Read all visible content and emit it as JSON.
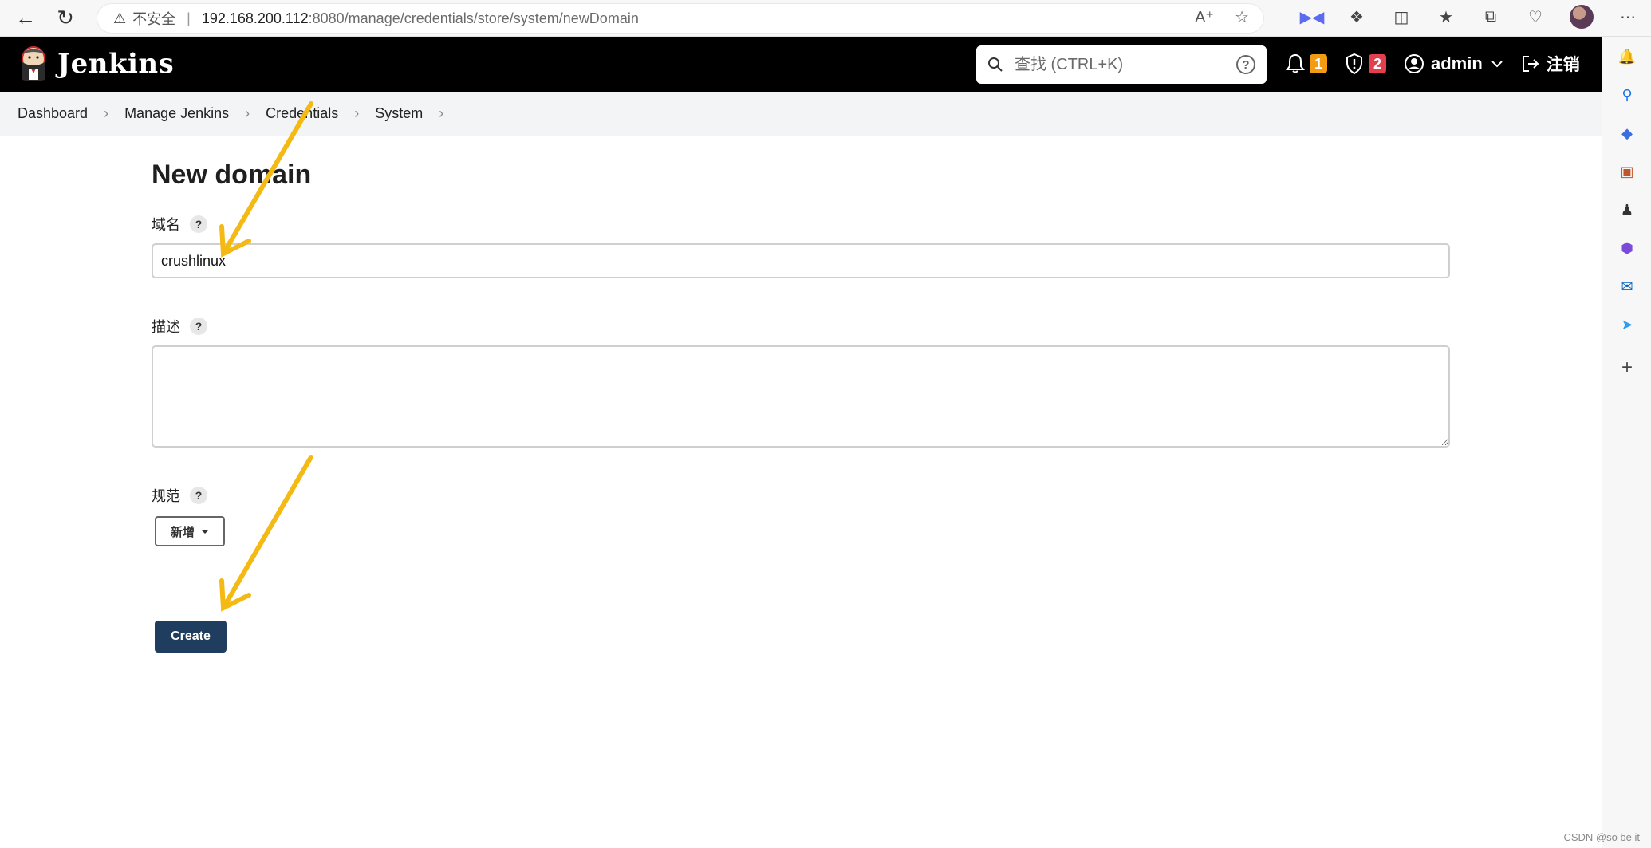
{
  "browser": {
    "security_label": "不安全",
    "url_host": "192.168.200.112",
    "url_path": ":8080/manage/credentials/store/system/newDomain"
  },
  "header": {
    "brand": "Jenkins",
    "search_placeholder": "查找 (CTRL+K)",
    "notifications_count": "1",
    "security_count": "2",
    "user": "admin",
    "logout": "注销"
  },
  "breadcrumb": [
    "Dashboard",
    "Manage Jenkins",
    "Credentials",
    "System"
  ],
  "main": {
    "title": "New domain",
    "domain_label": "域名",
    "domain_value": "crushlinux",
    "description_label": "描述",
    "description_value": "",
    "spec_label": "规范",
    "add_button": "新增",
    "create_button": "Create"
  },
  "watermark": "CSDN @so be it",
  "colors": {
    "header_bg": "#000000",
    "breadcrumb_bg": "#f3f4f6",
    "create_button": "#1f3e5f",
    "badge_notification": "#f39c12",
    "badge_security": "#e53e4f",
    "arrow": "#f5b914"
  },
  "icons": {
    "back": "arrow-left-icon",
    "refresh": "refresh-icon",
    "warning": "warning-icon",
    "bell": "bell-icon",
    "shield": "shield-icon",
    "user": "user-circle-icon",
    "logout": "logout-icon",
    "search": "search-icon",
    "help": "help-icon"
  }
}
